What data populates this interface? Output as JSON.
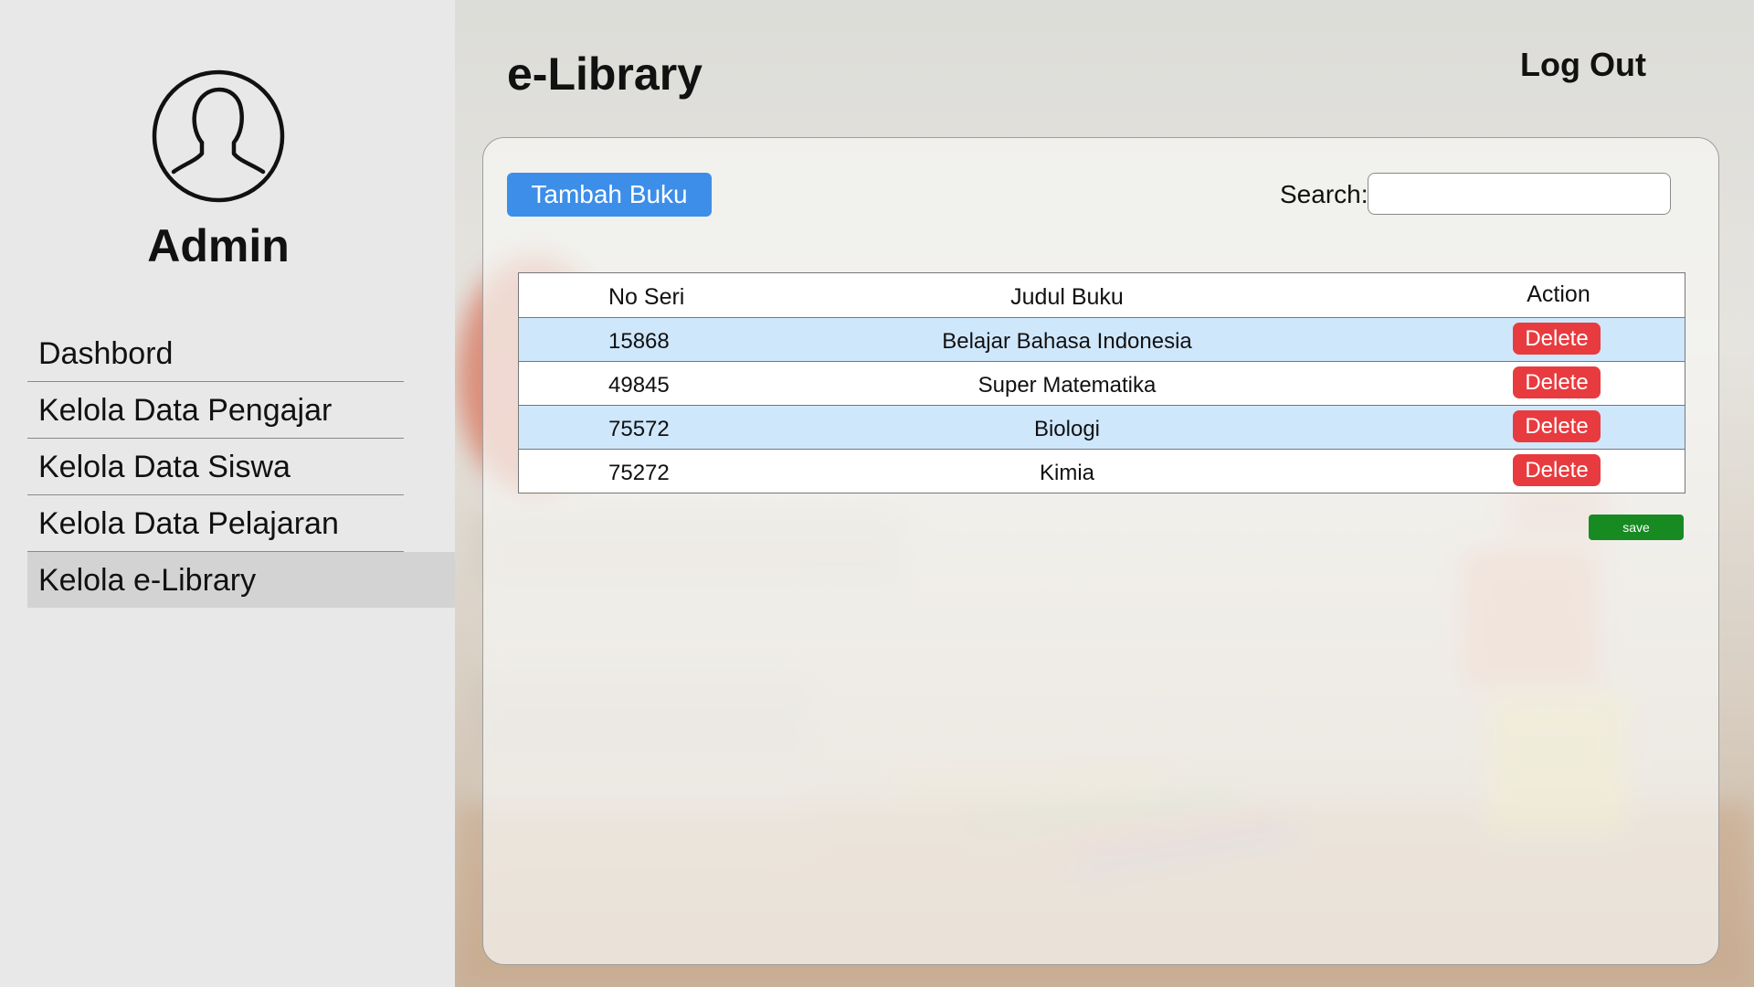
{
  "sidebar": {
    "user_name": "Admin",
    "avatar_icon": "user-avatar-icon",
    "nav_items": [
      {
        "label": "Dashbord",
        "active": false
      },
      {
        "label": "Kelola Data Pengajar",
        "active": false
      },
      {
        "label": "Kelola Data Siswa",
        "active": false
      },
      {
        "label": "Kelola Data Pelajaran",
        "active": false
      },
      {
        "label": "Kelola e-Library",
        "active": true
      }
    ]
  },
  "header": {
    "title": "e-Library",
    "logout_label": "Log Out"
  },
  "toolbar": {
    "add_button_label": "Tambah Buku",
    "search_label": "Search:",
    "search_value": ""
  },
  "table": {
    "columns": [
      "No Seri",
      "Judul Buku",
      "Action"
    ],
    "rows": [
      {
        "no_seri": "15868",
        "judul": "Belajar Bahasa Indonesia",
        "action": "Delete"
      },
      {
        "no_seri": "49845",
        "judul": "Super Matematika",
        "action": "Delete"
      },
      {
        "no_seri": "75572",
        "judul": "Biologi",
        "action": "Delete"
      },
      {
        "no_seri": "75272",
        "judul": "Kimia",
        "action": "Delete"
      }
    ]
  },
  "save_label": "save",
  "colors": {
    "primary": "#3d8ee8",
    "danger": "#e83b3f",
    "success": "#178a22",
    "row_highlight": "#cfe7fb",
    "sidebar_bg": "#e8e8e8"
  }
}
